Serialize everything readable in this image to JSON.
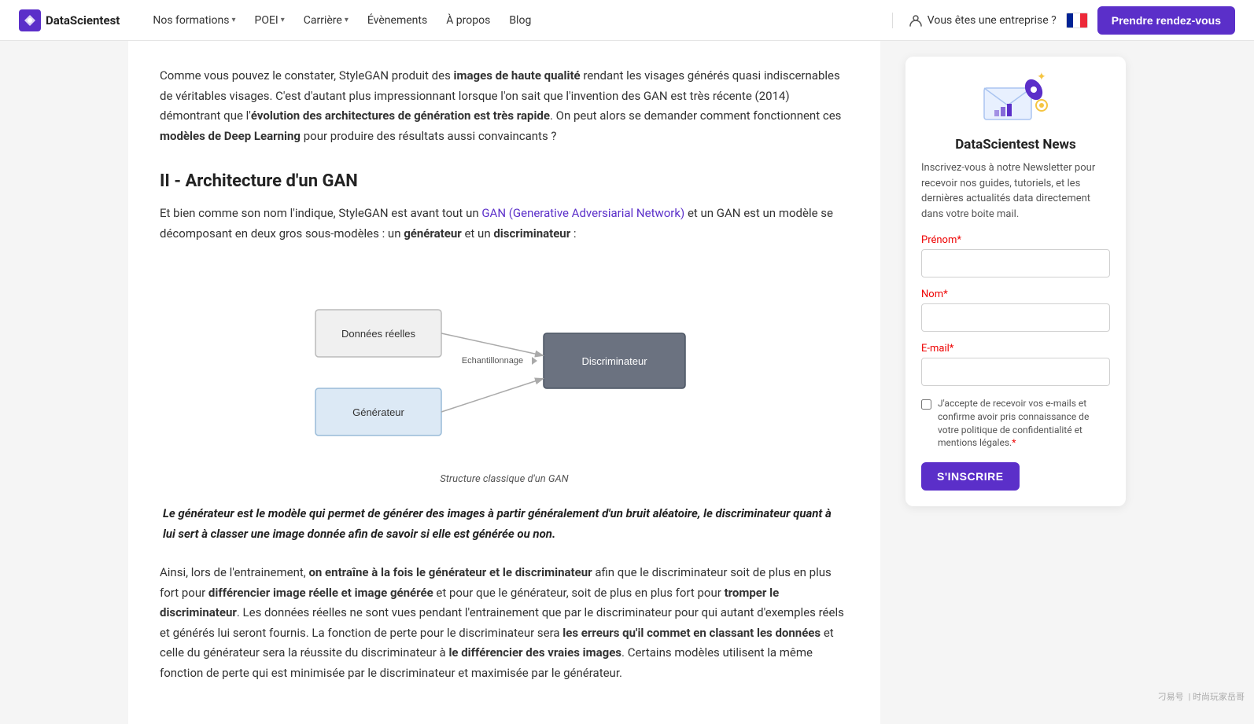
{
  "nav": {
    "logo_text": "DataScientest",
    "links": [
      {
        "label": "Nos formations",
        "has_dropdown": true
      },
      {
        "label": "POEI",
        "has_dropdown": true
      },
      {
        "label": "Carrière",
        "has_dropdown": true
      },
      {
        "label": "Évènements",
        "has_dropdown": false
      },
      {
        "label": "À propos",
        "has_dropdown": false
      },
      {
        "label": "Blog",
        "has_dropdown": false
      }
    ],
    "enterprise_label": "Vous êtes une entreprise ?",
    "cta_label": "Prendre rendez-vous"
  },
  "main": {
    "intro_text_1": "Comme vous pouvez le constater, StyleGAN produit des ",
    "intro_bold_1": "images de haute qualité",
    "intro_text_2": " rendant les visages générés quasi indiscernables de véritables visages. C'est d'autant plus impressionnant lorsque l'on sait que l'invention des GAN est très récente (2014) démontrant que l'",
    "intro_bold_2": "évolution des architectures de génération est très rapide",
    "intro_text_3": ". On peut alors se demander comment fonctionnent ces ",
    "intro_bold_3": "modèles de Deep Learning",
    "intro_text_4": " pour produire des résultats aussi convaincants ?",
    "section_title": "II - Architecture d'un GAN",
    "body_text_1a": "Et bien comme son nom l'indique, StyleGAN est avant tout un ",
    "body_link": "GAN (Generative Adversiarial Network)",
    "body_text_1b": " et un GAN est un modèle se décomposant en deux gros sous-modèles : un ",
    "body_bold_1": "générateur",
    "body_text_1c": " et un ",
    "body_bold_2": "discriminateur",
    "body_text_1d": " :",
    "diagram_caption": "Structure classique d'un GAN",
    "diagram": {
      "box1_label": "Données réelles",
      "box2_label": "Générateur",
      "box3_label": "Discriminateur",
      "arrow_label": "Echantillonnage"
    },
    "blockquote": "Le générateur est le modèle qui permet de générer des images à partir généralement d'un bruit aléatoire, le discriminateur quant à lui sert à classer une image donnée afin de savoir si elle est générée ou non.",
    "body_text_2a": "Ainsi, lors de l'entrainement, ",
    "body_bold_3": "on entraîne à la fois le générateur et le discriminateur",
    "body_text_2b": " afin que le discriminateur soit de plus en plus fort pour ",
    "body_bold_4": "différencier image réelle et image générée",
    "body_text_2c": " et pour que le générateur, soit de plus en plus fort pour ",
    "body_bold_5": "tromper le discriminateur",
    "body_text_2d": ". Les données réelles ne sont vues pendant l'entrainement que par le discriminateur pour qui autant d'exemples réels et générés lui seront fournis. La fonction de perte pour le discriminateur sera ",
    "body_bold_6": "les erreurs qu'il commet en classant les données",
    "body_text_2e": " et celle du générateur sera la réussite du discriminateur à ",
    "body_bold_7": "le différencier des vraies images",
    "body_text_2f": ". Certains modèles utilisent la même fonction de perte qui est minimisée par le discriminateur et maximisée par le générateur."
  },
  "sidebar": {
    "title": "DataScientest News",
    "description": "Inscrivez-vous à notre Newsletter pour recevoir nos guides, tutoriels, et les dernières actualités data directement dans votre boite mail.",
    "prenom_label": "Prénom",
    "prenom_required": "*",
    "nom_label": "Nom",
    "nom_required": "*",
    "email_label": "E-mail",
    "email_required": "*",
    "checkbox_text": "J'accepte de recevoir vos e-mails et confirme avoir pris connaissance de votre politique de confidentialité et mentions légales.",
    "checkbox_required": "*",
    "subscribe_label": "S'INSCRIRE"
  },
  "watermark": {
    "text1": "刁易号",
    "text2": "| 时尚玩家岳哥"
  }
}
